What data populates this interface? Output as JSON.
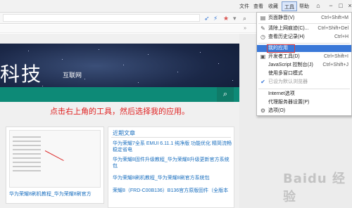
{
  "menubar": {
    "items": [
      "文件",
      "查看",
      "收藏",
      "工具",
      "帮助"
    ],
    "active_index": 3
  },
  "page": {
    "site_title": "科技",
    "site_subtitle": "互联网",
    "instruction": "点击右上角的工具，然后选择我的应用。",
    "thumbnail_caption": "华为荣耀8刷机教程_华为荣耀8刷官方",
    "article_heading": "近期文章",
    "articles": [
      "华为荣耀7全系 EMUI 6.11.1 纯净版 功能优化 精简流畅 稳定省电",
      "华为荣耀8固件升级教程_华为荣耀8升级更新官方系统包",
      "华为荣耀8刷机教程_华为荣耀8刷官方系统包",
      "荣耀8（FRD-C00B136）B136官方原版固件（全版本"
    ]
  },
  "tools_menu": {
    "items": [
      {
        "icon": "newspaper-icon",
        "label": "页面静音(V)",
        "shortcut": "Ctrl+Shift+M"
      },
      {
        "icon": "broom-icon",
        "label": "清除上网痕迹(C)...",
        "shortcut": "Ctrl+Shift+Del"
      },
      {
        "icon": "history-icon",
        "label": "查看历史记录(H)",
        "shortcut": "Ctrl+H"
      },
      {
        "icon": "",
        "label": "我的应用",
        "shortcut": "",
        "highlighted": true
      },
      {
        "icon": "code-icon",
        "label": "开发者工具(D)",
        "shortcut": "Ctrl+Shift+I"
      },
      {
        "icon": "",
        "label": "JavaScript 控制台(J)",
        "shortcut": "Ctrl+Shift+J"
      },
      {
        "icon": "",
        "label": "使用多窗口模式",
        "shortcut": ""
      },
      {
        "icon": "check-icon",
        "label": "已设为默认浏览器",
        "shortcut": "",
        "disabled": true
      },
      {
        "icon": "",
        "label": "Internet选项",
        "shortcut": ""
      },
      {
        "icon": "",
        "label": "代理服务器设置(P)",
        "shortcut": ""
      },
      {
        "icon": "gear-icon",
        "label": "选项(O)",
        "shortcut": ""
      }
    ]
  },
  "watermark": "Baidu 经验"
}
